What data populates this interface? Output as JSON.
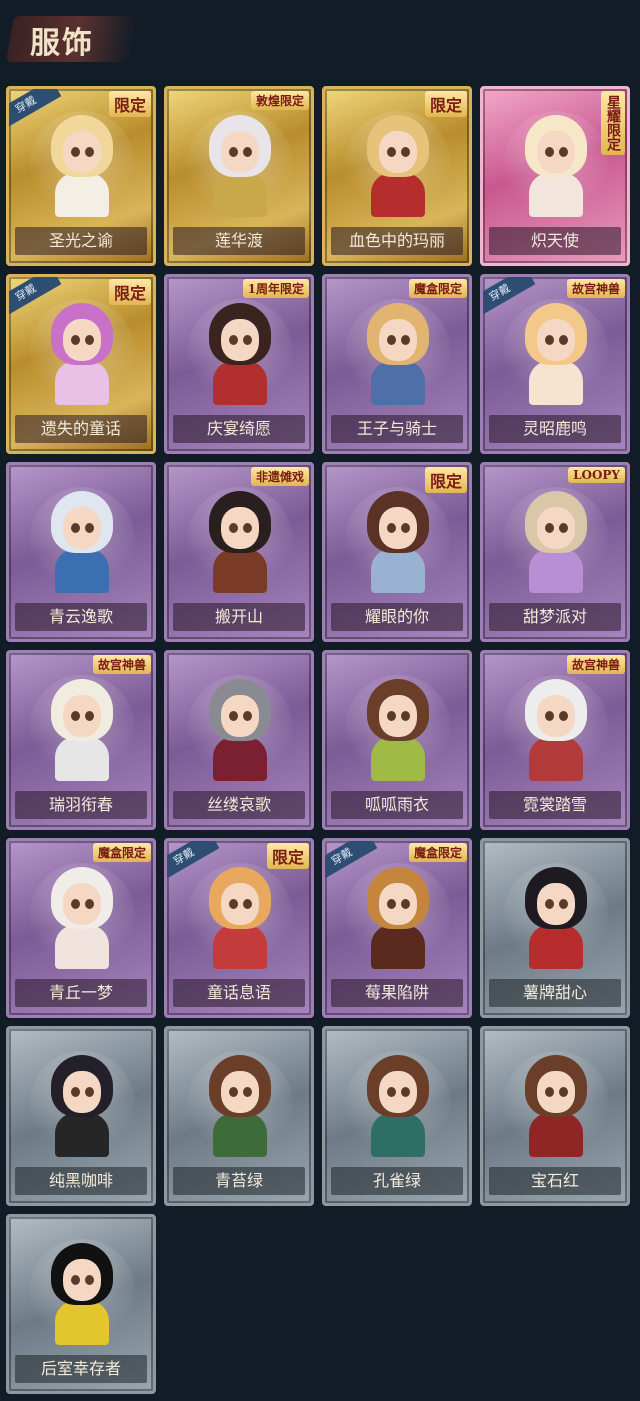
{
  "header": {
    "title": "服饰"
  },
  "worn_tag": "穿戴",
  "cards": [
    {
      "name": "圣光之谕",
      "frame": "gold",
      "badge": "限定",
      "worn": true,
      "hair": "#f2d79a",
      "outfit": "#f4efe4"
    },
    {
      "name": "莲华渡",
      "frame": "gold",
      "badge": "敦煌限定",
      "worn": false,
      "hair": "#e8e4ea",
      "outfit": "#c9a84c"
    },
    {
      "name": "血色中的玛丽",
      "frame": "gold",
      "badge": "限定",
      "worn": false,
      "hair": "#e7c27b",
      "outfit": "#b52d2d"
    },
    {
      "name": "炽天使",
      "frame": "pink",
      "badge": "星耀限定",
      "worn": false,
      "hair": "#f6e7c8",
      "outfit": "#f2e5dc"
    },
    {
      "name": "遗失的童话",
      "frame": "gold",
      "badge": "限定",
      "worn": true,
      "hair": "#c970c8",
      "outfit": "#e9c0e6"
    },
    {
      "name": "庆宴绮愿",
      "frame": "purple",
      "badge": "1周年限定",
      "worn": false,
      "hair": "#3b2420",
      "outfit": "#b22f2f"
    },
    {
      "name": "王子与骑士",
      "frame": "purple",
      "badge": "魔盒限定",
      "worn": false,
      "hair": "#e1b570",
      "outfit": "#4f6fa8"
    },
    {
      "name": "灵昭鹿鸣",
      "frame": "purple",
      "badge": "故宫神兽",
      "worn": true,
      "hair": "#f3c889",
      "outfit": "#f6e4d0"
    },
    {
      "name": "青云逸歌",
      "frame": "purple",
      "badge": "",
      "worn": false,
      "hair": "#dfe6ef",
      "outfit": "#3b6fb2"
    },
    {
      "name": "搬开山",
      "frame": "purple",
      "badge": "非遗傩戏",
      "worn": false,
      "hair": "#2a1f1f",
      "outfit": "#7a3a28"
    },
    {
      "name": "耀眼的你",
      "frame": "purple",
      "badge": "限定",
      "worn": false,
      "hair": "#5a3326",
      "outfit": "#9ab2d1"
    },
    {
      "name": "甜梦派对",
      "frame": "purple",
      "badge": "LOOPY",
      "worn": false,
      "hair": "#d9c7a8",
      "outfit": "#b88fd4"
    },
    {
      "name": "瑞羽衔春",
      "frame": "purple",
      "badge": "故宫神兽",
      "worn": false,
      "hair": "#f1ece0",
      "outfit": "#e6e6e6"
    },
    {
      "name": "丝缕哀歌",
      "frame": "purple",
      "badge": "",
      "worn": false,
      "hair": "#8a8a92",
      "outfit": "#7b1f33"
    },
    {
      "name": "呱呱雨衣",
      "frame": "purple",
      "badge": "",
      "worn": false,
      "hair": "#6b3e2a",
      "outfit": "#9fbb45"
    },
    {
      "name": "霓裳踏雪",
      "frame": "purple",
      "badge": "故宫神兽",
      "worn": false,
      "hair": "#ededed",
      "outfit": "#b33a3a"
    },
    {
      "name": "青丘一梦",
      "frame": "purple",
      "badge": "魔盒限定",
      "worn": false,
      "hair": "#f0ece8",
      "outfit": "#f1e3de"
    },
    {
      "name": "童话息语",
      "frame": "purple",
      "badge": "限定",
      "worn": true,
      "hair": "#e8a85e",
      "outfit": "#c33b3b"
    },
    {
      "name": "莓果陷阱",
      "frame": "purple",
      "badge": "魔盒限定",
      "worn": true,
      "hair": "#c4853c",
      "outfit": "#5a2a1e"
    },
    {
      "name": "薯牌甜心",
      "frame": "gray",
      "badge": "",
      "worn": false,
      "hair": "#1e1a22",
      "outfit": "#b72d2d"
    },
    {
      "name": "纯黑咖啡",
      "frame": "gray",
      "badge": "",
      "worn": false,
      "hair": "#24202a",
      "outfit": "#262626"
    },
    {
      "name": "青苔绿",
      "frame": "gray",
      "badge": "",
      "worn": false,
      "hair": "#6b3e2a",
      "outfit": "#3d6b3a"
    },
    {
      "name": "孔雀绿",
      "frame": "gray",
      "badge": "",
      "worn": false,
      "hair": "#6b3e2a",
      "outfit": "#2f6e62"
    },
    {
      "name": "宝石红",
      "frame": "gray",
      "badge": "",
      "worn": false,
      "hair": "#6b3e2a",
      "outfit": "#8f2525"
    },
    {
      "name": "后室幸存者",
      "frame": "gray",
      "badge": "",
      "worn": false,
      "hair": "#111111",
      "outfit": "#e3c52e"
    }
  ]
}
